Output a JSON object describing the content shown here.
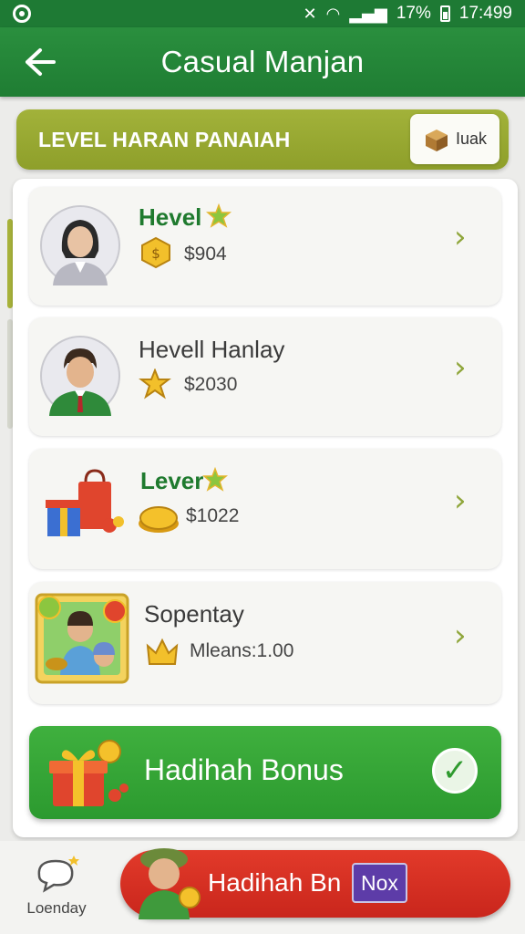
{
  "status_bar": {
    "battery": "17%",
    "time": "17:499"
  },
  "header": {
    "back_icon": "arrow-left-icon",
    "title": "Casual Manjan"
  },
  "banner": {
    "title": "LEVEL HARAN PANAIAH",
    "button_label": "Iuak",
    "button_icon": "box-icon"
  },
  "cards": [
    {
      "title": "Hevel",
      "value": "$904",
      "value_icon": "coin-badge-icon",
      "title_icon": "star-icon"
    },
    {
      "title": "Hevell Hanlay",
      "value": "$2030",
      "value_icon": "star-badge-icon"
    },
    {
      "title": "Lever",
      "value": "$1022",
      "value_icon": "gold-coins-icon",
      "title_icon": "star-icon"
    },
    {
      "title": "Sopentay",
      "value": "Mleans:1.00",
      "value_icon": "crown-badge-icon"
    }
  ],
  "bonus": {
    "label": "Hadihah Bonus",
    "icon": "gift-icon",
    "check_icon": "check-icon"
  },
  "bottom_nav": {
    "label": "Loenday",
    "icon": "chat-bubble-icon"
  },
  "cta": {
    "label": "Hadihah Bn",
    "tag": "Nox"
  },
  "colors": {
    "primary_green": "#1f7d33",
    "banner_olive": "#9aab34",
    "cta_red": "#d42f22",
    "tag_purple": "#5d3ca8"
  }
}
